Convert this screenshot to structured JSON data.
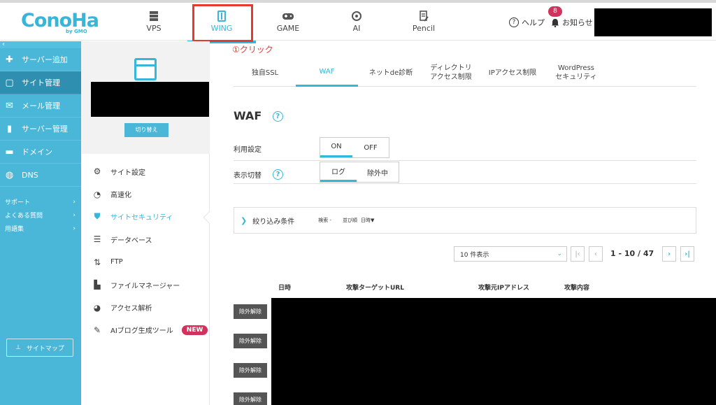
{
  "header": {
    "logo_text": "ConoHa",
    "logo_sub": "by GMO",
    "nav": [
      {
        "label": "VPS",
        "icon": "server-icon"
      },
      {
        "label": "WING",
        "icon": "wing-icon",
        "active": true
      },
      {
        "label": "GAME",
        "icon": "gamepad-icon"
      },
      {
        "label": "AI",
        "icon": "ai-icon"
      },
      {
        "label": "Pencil",
        "icon": "pencil-icon"
      }
    ],
    "help_label": "ヘルプ",
    "notice_label": "お知らせ",
    "notice_count": "8"
  },
  "sidebar": {
    "collapse": "‹",
    "items": [
      {
        "label": "サーバー追加",
        "icon": "plus-icon"
      },
      {
        "label": "サイト管理",
        "icon": "window-icon",
        "active": true
      },
      {
        "label": "メール管理",
        "icon": "mail-icon"
      },
      {
        "label": "サーバー管理",
        "icon": "server-manage-icon"
      },
      {
        "label": "ドメイン",
        "icon": "domain-icon"
      },
      {
        "label": "DNS",
        "icon": "globe-icon"
      }
    ],
    "sub_items": [
      {
        "label": "サポート"
      },
      {
        "label": "よくある質問"
      },
      {
        "label": "用語集"
      }
    ],
    "sitemap_label": "サイトマップ"
  },
  "site_panel": {
    "switch_label": "切り替え",
    "menu": [
      {
        "label": "サイト設定",
        "icon": "site-settings-icon"
      },
      {
        "label": "高速化",
        "icon": "stopwatch-icon"
      },
      {
        "label": "サイトセキュリティ",
        "icon": "shield-icon",
        "active": true
      },
      {
        "label": "データベース",
        "icon": "database-icon"
      },
      {
        "label": "FTP",
        "icon": "transfer-icon"
      },
      {
        "label": "ファイルマネージャー",
        "icon": "folder-icon"
      },
      {
        "label": "アクセス解析",
        "icon": "pie-chart-icon"
      },
      {
        "label": "AIブログ生成ツール",
        "icon": "ai-blog-icon",
        "badge": "NEW"
      }
    ]
  },
  "main": {
    "click_note": "①クリック",
    "tabs": [
      {
        "label": "独自SSL"
      },
      {
        "label": "WAF",
        "active": true
      },
      {
        "label": "ネットde診断"
      },
      {
        "label": "ディレクトリ\nアクセス制限"
      },
      {
        "label": "IPアクセス制限"
      },
      {
        "label": "WordPress\nセキュリティ"
      }
    ],
    "title": "WAF",
    "usage_label": "利用設定",
    "usage_on": "ON",
    "usage_off": "OFF",
    "view_label": "表示切替",
    "view_log": "ログ",
    "view_excluded": "除外中",
    "filter_label": "絞り込み条件",
    "filter_search": "検索 -",
    "filter_sort": "並び順",
    "filter_sort_value": "日時▼",
    "per_page": "10 件表示",
    "page_range": "1 - 10 / 47",
    "columns": [
      "日時",
      "攻撃ターゲットURL",
      "攻撃元IPアドレス",
      "攻撃内容"
    ],
    "row_button": "除外解除"
  },
  "colors": {
    "accent": "#36b6d8",
    "sidebar": "#4ab7d9",
    "highlight_box": "#e53a2f",
    "badge": "#d1335d"
  }
}
